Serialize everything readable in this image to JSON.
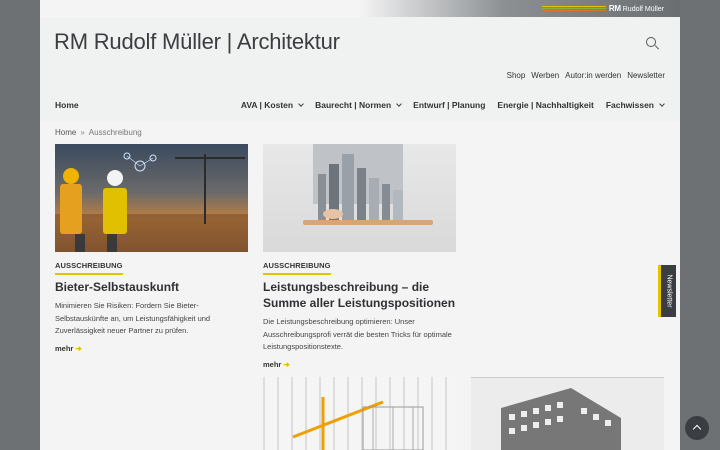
{
  "brand": {
    "short": "RM",
    "name": "Rudolf Müller",
    "bar_colors": [
      "#e3c300",
      "#7ab648",
      "#e37222"
    ]
  },
  "site_title": "RM Rudolf Müller | Architektur",
  "utility_nav": [
    "Shop",
    "Werben",
    "Autor:in werden",
    "Newsletter"
  ],
  "main_nav": {
    "home": "Home",
    "items": [
      {
        "label": "AVA | Kosten",
        "dropdown": true
      },
      {
        "label": "Baurecht | Normen",
        "dropdown": true
      },
      {
        "label": "Entwurf | Planung",
        "dropdown": false
      },
      {
        "label": "Energie | Nachhaltigkeit",
        "dropdown": false
      },
      {
        "label": "Fachwissen",
        "dropdown": true
      }
    ]
  },
  "breadcrumb": {
    "home": "Home",
    "separator": "»",
    "current": "Ausschreibung"
  },
  "cards": [
    {
      "tag": "AUSSCHREIBUNG",
      "title": "Bieter-Selbstauskunft",
      "text": "Minimieren Sie Risiken: Fordern Sie Bieter-Selbstauskünfte an, um Leistungsfähigkeit und Zuverlässigkeit neuer Partner zu prüfen.",
      "more": "mehr"
    },
    {
      "tag": "AUSSCHREIBUNG",
      "title": "Leistungsbeschreibung – die Summe aller Leistungspositionen",
      "text": "Die Leistungsbeschreibung optimieren: Unser Ausschreibungsprofi verrät die besten Tricks für optimale Leistungspositionstexte.",
      "more": "mehr"
    }
  ],
  "newsletter_tab": "Newsletter",
  "accent_color": "#e3c300"
}
